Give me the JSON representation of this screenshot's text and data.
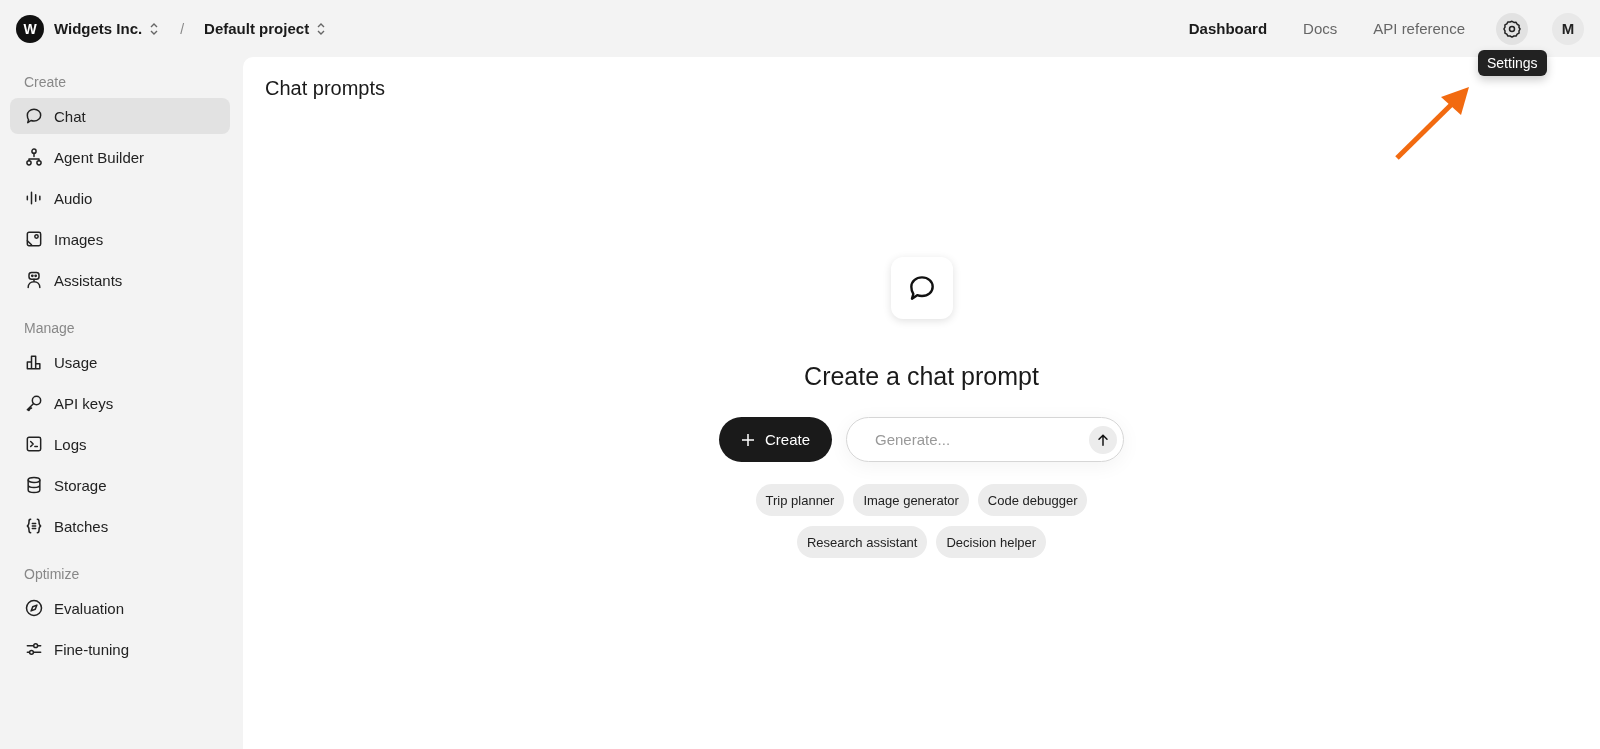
{
  "header": {
    "org": {
      "initial": "W",
      "name": "Widgets Inc."
    },
    "separator": "/",
    "project": "Default project",
    "nav": [
      {
        "label": "Dashboard",
        "selected": true
      },
      {
        "label": "Docs",
        "selected": false
      },
      {
        "label": "API reference",
        "selected": false
      }
    ],
    "settings_tooltip": "Settings",
    "avatar": "M"
  },
  "sidebar": {
    "sections": [
      {
        "title": "Create",
        "items": [
          {
            "label": "Chat",
            "selected": true
          },
          {
            "label": "Agent Builder",
            "selected": false
          },
          {
            "label": "Audio",
            "selected": false
          },
          {
            "label": "Images",
            "selected": false
          },
          {
            "label": "Assistants",
            "selected": false
          }
        ]
      },
      {
        "title": "Manage",
        "items": [
          {
            "label": "Usage",
            "selected": false
          },
          {
            "label": "API keys",
            "selected": false
          },
          {
            "label": "Logs",
            "selected": false
          },
          {
            "label": "Storage",
            "selected": false
          },
          {
            "label": "Batches",
            "selected": false
          }
        ]
      },
      {
        "title": "Optimize",
        "items": [
          {
            "label": "Evaluation",
            "selected": false
          },
          {
            "label": "Fine-tuning",
            "selected": false
          }
        ]
      }
    ]
  },
  "main": {
    "title": "Chat prompts",
    "empty_title": "Create a chat prompt",
    "create_button": "Create",
    "generate": {
      "placeholder": "Generate..."
    },
    "suggestions": [
      [
        "Trip planner",
        "Image generator",
        "Code debugger"
      ],
      [
        "Research assistant",
        "Decision helper"
      ]
    ]
  }
}
